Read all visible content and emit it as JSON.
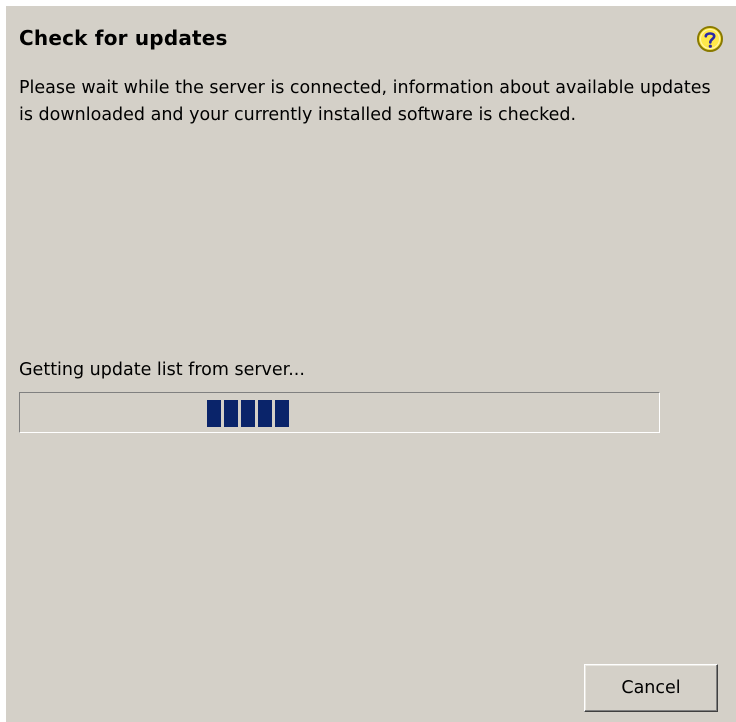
{
  "dialog": {
    "title": "Check for updates",
    "help_icon": "help-question-icon",
    "description": "Please wait while the server is connected, information about available updates is downloaded and your currently installed software is checked.",
    "status": "Getting update list from server...",
    "progress": {
      "style": "marquee",
      "segment_count": 5,
      "color": "#0a246a"
    },
    "cancel_label": "Cancel"
  },
  "colors": {
    "background": "#d4d0c8",
    "progress_fill": "#0a246a",
    "help_icon_fill": "#ffe94a",
    "help_icon_border": "#8a7a00"
  }
}
